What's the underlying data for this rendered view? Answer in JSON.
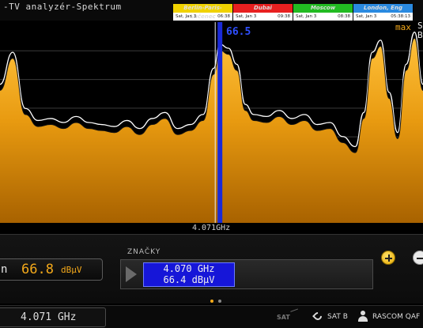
{
  "header": {
    "title": "-TV analyzér-Spektrum"
  },
  "world_clocks": [
    {
      "city": "Berlin-Paris-Lučenec",
      "date": "Sat, Jan 3",
      "time": "06:38",
      "color": "#f0d200"
    },
    {
      "city": "Dubai",
      "date": "Sat, Jan 3",
      "time": "09:38",
      "color": "#e82020"
    },
    {
      "city": "Moscow",
      "date": "Sat, Jan 3",
      "time": "08:38",
      "color": "#22bb22"
    },
    {
      "city": "London, Eng",
      "date": "Sat, Jan 3",
      "time": "05:38:13",
      "color": "#2a8ae0"
    }
  ],
  "spectrum": {
    "center_frequency_label": "4.071GHz",
    "marker_value": "66.5",
    "max_label": "max",
    "max_legend": [
      "S",
      "B"
    ],
    "trace_color": "#f4a91a",
    "marker_color": "#1a2ad8"
  },
  "chart_data": {
    "type": "area",
    "x": [
      0,
      0.03,
      0.06,
      0.09,
      0.12,
      0.15,
      0.18,
      0.21,
      0.24,
      0.27,
      0.3,
      0.33,
      0.36,
      0.39,
      0.42,
      0.45,
      0.48,
      0.505,
      0.52,
      0.54,
      0.56,
      0.58,
      0.6,
      0.63,
      0.66,
      0.69,
      0.72,
      0.75,
      0.78,
      0.81,
      0.84,
      0.86,
      0.88,
      0.9,
      0.92,
      0.94,
      0.96,
      0.98,
      1.0
    ],
    "values": [
      0.66,
      0.82,
      0.54,
      0.48,
      0.49,
      0.47,
      0.5,
      0.47,
      0.46,
      0.45,
      0.48,
      0.44,
      0.49,
      0.52,
      0.44,
      0.46,
      0.51,
      0.74,
      0.86,
      0.84,
      0.76,
      0.56,
      0.51,
      0.5,
      0.53,
      0.49,
      0.51,
      0.46,
      0.47,
      0.4,
      0.35,
      0.52,
      0.82,
      0.88,
      0.62,
      0.42,
      0.76,
      0.92,
      0.66
    ],
    "max_hold": [
      0.69,
      0.85,
      0.57,
      0.51,
      0.52,
      0.5,
      0.53,
      0.5,
      0.49,
      0.48,
      0.51,
      0.47,
      0.52,
      0.55,
      0.47,
      0.49,
      0.54,
      0.77,
      0.89,
      0.87,
      0.79,
      0.59,
      0.54,
      0.53,
      0.56,
      0.52,
      0.54,
      0.49,
      0.5,
      0.43,
      0.38,
      0.55,
      0.85,
      0.91,
      0.65,
      0.45,
      0.79,
      0.95,
      0.69
    ],
    "marker_x": 0.52,
    "xlabel": "4.071GHz"
  },
  "level": {
    "prefix": "n",
    "value": "66.8",
    "unit": "dBµV"
  },
  "markers": {
    "title": "ZNAČKY",
    "frequency": "4.070 GHz",
    "level": "66.4 dBµV"
  },
  "status": {
    "frequency": "4.071 GHz",
    "sat_logo": "SAT",
    "satellite": "SAT B",
    "user": "RASCOM QAF"
  }
}
